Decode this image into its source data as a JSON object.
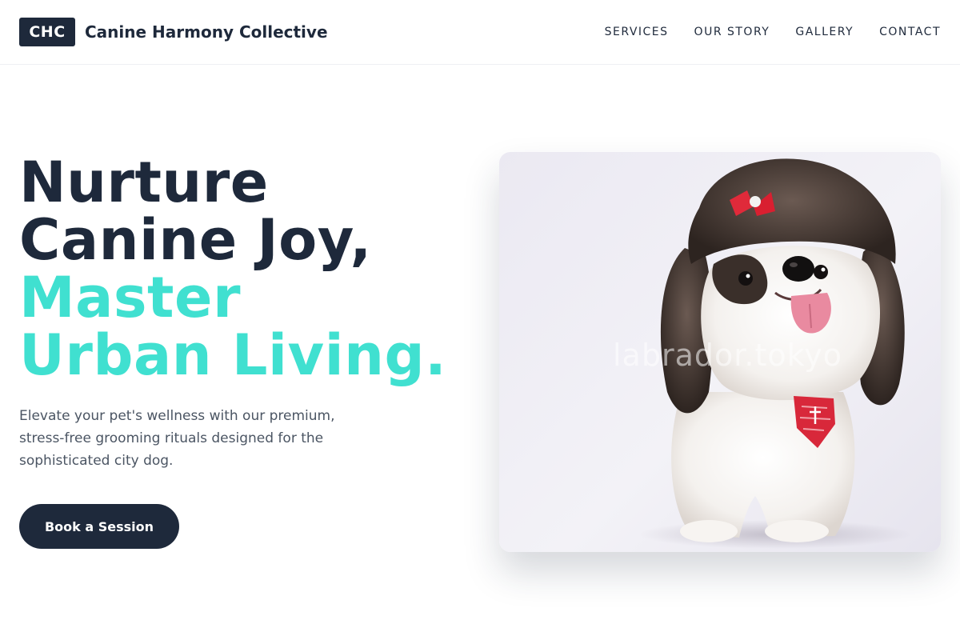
{
  "header": {
    "logo_text": "CHC",
    "brand_name": "Canine Harmony Collective",
    "nav": [
      "SERVICES",
      "OUR STORY",
      "GALLERY",
      "CONTACT"
    ]
  },
  "hero": {
    "title_line1": "Nurture",
    "title_line2": "Canine Joy,",
    "title_line3": "Master",
    "title_line4": "Urban Living.",
    "subtitle": "Elevate your pet's wellness with our premium, stress-free grooming rituals designed for the sophisticated city dog.",
    "cta_label": "Book a Session"
  },
  "image": {
    "subject": "shih-tzu-dog-photo",
    "watermark": "labrador.tokyo"
  },
  "colors": {
    "primary": "#1e293b",
    "accent": "#40e0d0",
    "body_text": "#4b5563"
  }
}
